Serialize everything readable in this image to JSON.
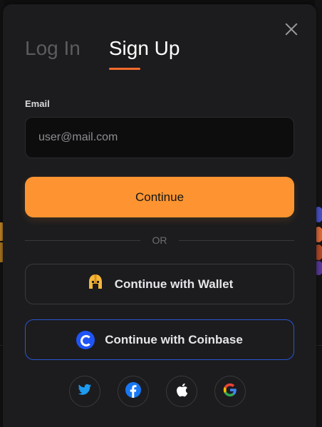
{
  "modal": {
    "tabs": [
      {
        "label": "Log In",
        "active": false
      },
      {
        "label": "Sign Up",
        "active": true
      }
    ],
    "email_label": "Email",
    "email_placeholder": "user@mail.com",
    "continue_label": "Continue",
    "divider_text": "OR",
    "wallet_button_label": "Continue with Wallet",
    "coinbase_button_label": "Continue with Coinbase",
    "social_icons": [
      "twitter-icon",
      "facebook-icon",
      "apple-icon",
      "google-icon"
    ]
  },
  "colors": {
    "accent": "#fd9431",
    "tab_underline": "#f46b2c",
    "coinbase_blue": "#1f54f5",
    "modal_bg": "#1c1c1e"
  }
}
